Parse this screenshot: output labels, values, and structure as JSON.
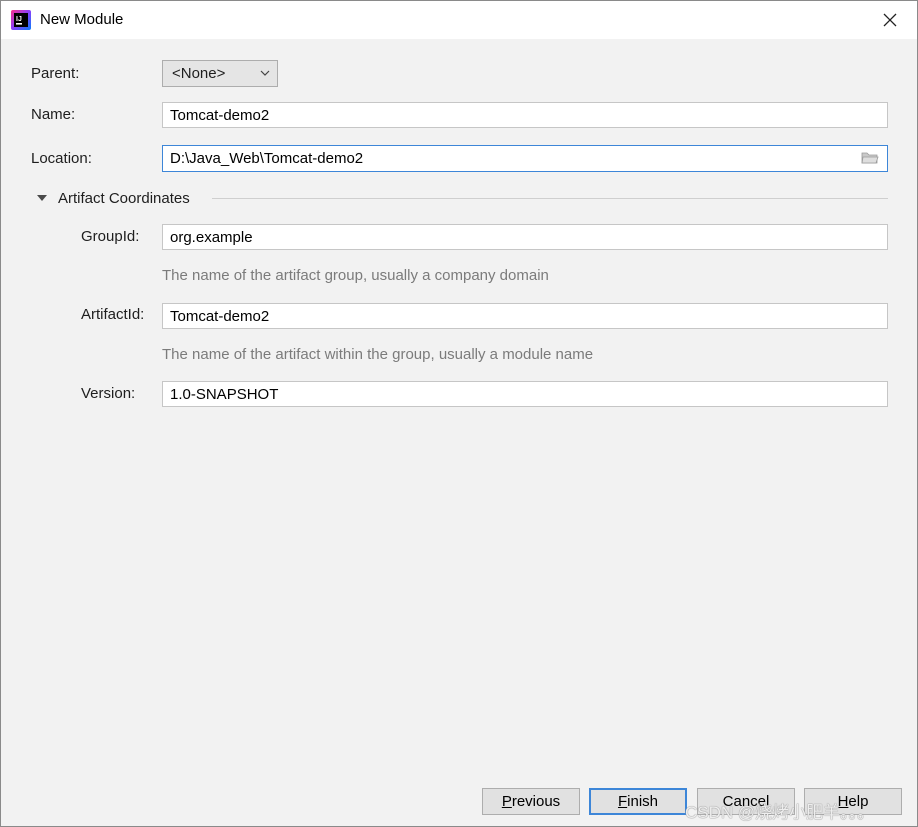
{
  "window": {
    "title": "New Module",
    "close_icon": "close-icon",
    "app_icon": "intellij-idea-icon"
  },
  "form": {
    "parent_label": "Parent:",
    "parent_value": "<None>",
    "name_label": "Name:",
    "name_value": "Tomcat-demo2",
    "location_label": "Location:",
    "location_value": "D:\\Java_Web\\Tomcat-demo2"
  },
  "artifact": {
    "section_title": "Artifact Coordinates",
    "groupid_label": "GroupId:",
    "groupid_value": "org.example",
    "groupid_hint": "The name of the artifact group, usually a company domain",
    "artifactid_label": "ArtifactId:",
    "artifactid_value": "Tomcat-demo2",
    "artifactid_hint": "The name of the artifact within the group, usually a module name",
    "version_label": "Version:",
    "version_value": "1.0-SNAPSHOT"
  },
  "buttons": {
    "previous_mnemonic": "P",
    "previous_rest": "revious",
    "finish_mnemonic": "F",
    "finish_rest": "inish",
    "cancel": "Cancel",
    "help_mnemonic": "H",
    "help_rest": "elp"
  },
  "watermark": "CSDN @烧烤小肥羊。。。",
  "colors": {
    "focus_border": "#3d86d8",
    "background": "#f2f2f2",
    "hint_text": "#7b7b7b"
  }
}
